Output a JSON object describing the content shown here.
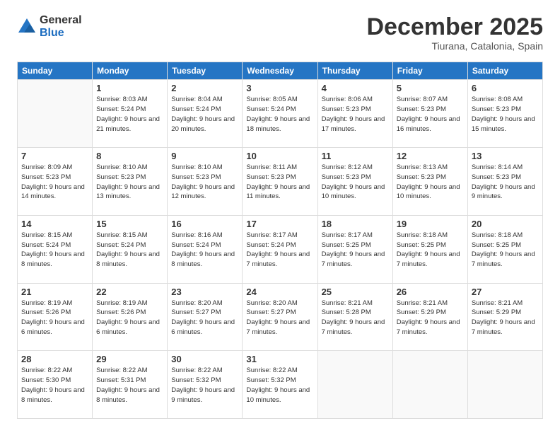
{
  "header": {
    "logo_general": "General",
    "logo_blue": "Blue",
    "month_title": "December 2025",
    "subtitle": "Tiurana, Catalonia, Spain"
  },
  "days_of_week": [
    "Sunday",
    "Monday",
    "Tuesday",
    "Wednesday",
    "Thursday",
    "Friday",
    "Saturday"
  ],
  "weeks": [
    [
      {
        "day": "",
        "info": ""
      },
      {
        "day": "1",
        "info": "Sunrise: 8:03 AM\nSunset: 5:24 PM\nDaylight: 9 hours\nand 21 minutes."
      },
      {
        "day": "2",
        "info": "Sunrise: 8:04 AM\nSunset: 5:24 PM\nDaylight: 9 hours\nand 20 minutes."
      },
      {
        "day": "3",
        "info": "Sunrise: 8:05 AM\nSunset: 5:24 PM\nDaylight: 9 hours\nand 18 minutes."
      },
      {
        "day": "4",
        "info": "Sunrise: 8:06 AM\nSunset: 5:23 PM\nDaylight: 9 hours\nand 17 minutes."
      },
      {
        "day": "5",
        "info": "Sunrise: 8:07 AM\nSunset: 5:23 PM\nDaylight: 9 hours\nand 16 minutes."
      },
      {
        "day": "6",
        "info": "Sunrise: 8:08 AM\nSunset: 5:23 PM\nDaylight: 9 hours\nand 15 minutes."
      }
    ],
    [
      {
        "day": "7",
        "info": "Sunrise: 8:09 AM\nSunset: 5:23 PM\nDaylight: 9 hours\nand 14 minutes."
      },
      {
        "day": "8",
        "info": "Sunrise: 8:10 AM\nSunset: 5:23 PM\nDaylight: 9 hours\nand 13 minutes."
      },
      {
        "day": "9",
        "info": "Sunrise: 8:10 AM\nSunset: 5:23 PM\nDaylight: 9 hours\nand 12 minutes."
      },
      {
        "day": "10",
        "info": "Sunrise: 8:11 AM\nSunset: 5:23 PM\nDaylight: 9 hours\nand 11 minutes."
      },
      {
        "day": "11",
        "info": "Sunrise: 8:12 AM\nSunset: 5:23 PM\nDaylight: 9 hours\nand 10 minutes."
      },
      {
        "day": "12",
        "info": "Sunrise: 8:13 AM\nSunset: 5:23 PM\nDaylight: 9 hours\nand 10 minutes."
      },
      {
        "day": "13",
        "info": "Sunrise: 8:14 AM\nSunset: 5:23 PM\nDaylight: 9 hours\nand 9 minutes."
      }
    ],
    [
      {
        "day": "14",
        "info": "Sunrise: 8:15 AM\nSunset: 5:24 PM\nDaylight: 9 hours\nand 8 minutes."
      },
      {
        "day": "15",
        "info": "Sunrise: 8:15 AM\nSunset: 5:24 PM\nDaylight: 9 hours\nand 8 minutes."
      },
      {
        "day": "16",
        "info": "Sunrise: 8:16 AM\nSunset: 5:24 PM\nDaylight: 9 hours\nand 8 minutes."
      },
      {
        "day": "17",
        "info": "Sunrise: 8:17 AM\nSunset: 5:24 PM\nDaylight: 9 hours\nand 7 minutes."
      },
      {
        "day": "18",
        "info": "Sunrise: 8:17 AM\nSunset: 5:25 PM\nDaylight: 9 hours\nand 7 minutes."
      },
      {
        "day": "19",
        "info": "Sunrise: 8:18 AM\nSunset: 5:25 PM\nDaylight: 9 hours\nand 7 minutes."
      },
      {
        "day": "20",
        "info": "Sunrise: 8:18 AM\nSunset: 5:25 PM\nDaylight: 9 hours\nand 7 minutes."
      }
    ],
    [
      {
        "day": "21",
        "info": "Sunrise: 8:19 AM\nSunset: 5:26 PM\nDaylight: 9 hours\nand 6 minutes."
      },
      {
        "day": "22",
        "info": "Sunrise: 8:19 AM\nSunset: 5:26 PM\nDaylight: 9 hours\nand 6 minutes."
      },
      {
        "day": "23",
        "info": "Sunrise: 8:20 AM\nSunset: 5:27 PM\nDaylight: 9 hours\nand 6 minutes."
      },
      {
        "day": "24",
        "info": "Sunrise: 8:20 AM\nSunset: 5:27 PM\nDaylight: 9 hours\nand 7 minutes."
      },
      {
        "day": "25",
        "info": "Sunrise: 8:21 AM\nSunset: 5:28 PM\nDaylight: 9 hours\nand 7 minutes."
      },
      {
        "day": "26",
        "info": "Sunrise: 8:21 AM\nSunset: 5:29 PM\nDaylight: 9 hours\nand 7 minutes."
      },
      {
        "day": "27",
        "info": "Sunrise: 8:21 AM\nSunset: 5:29 PM\nDaylight: 9 hours\nand 7 minutes."
      }
    ],
    [
      {
        "day": "28",
        "info": "Sunrise: 8:22 AM\nSunset: 5:30 PM\nDaylight: 9 hours\nand 8 minutes."
      },
      {
        "day": "29",
        "info": "Sunrise: 8:22 AM\nSunset: 5:31 PM\nDaylight: 9 hours\nand 8 minutes."
      },
      {
        "day": "30",
        "info": "Sunrise: 8:22 AM\nSunset: 5:32 PM\nDaylight: 9 hours\nand 9 minutes."
      },
      {
        "day": "31",
        "info": "Sunrise: 8:22 AM\nSunset: 5:32 PM\nDaylight: 9 hours\nand 10 minutes."
      },
      {
        "day": "",
        "info": ""
      },
      {
        "day": "",
        "info": ""
      },
      {
        "day": "",
        "info": ""
      }
    ]
  ]
}
